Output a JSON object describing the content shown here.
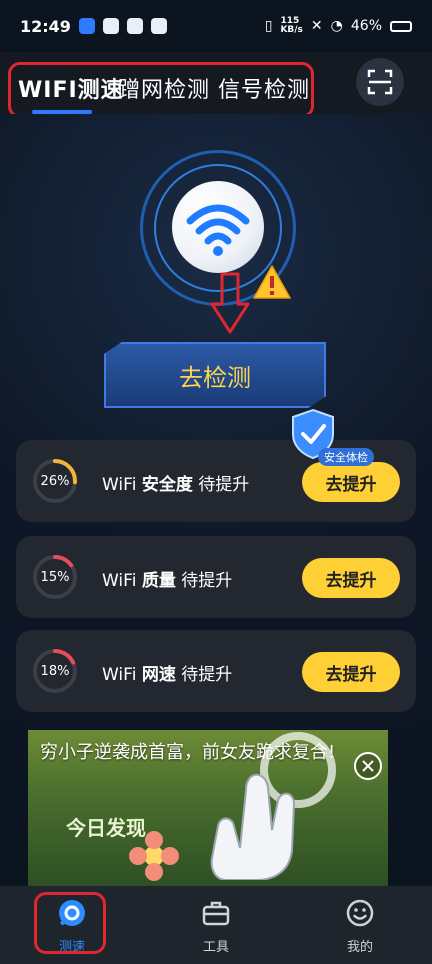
{
  "status": {
    "time": "12:49",
    "net_speed_value": "115",
    "net_speed_unit": "KB/s",
    "battery": "46%"
  },
  "tabs": [
    {
      "label": "WIFI测速",
      "active": true
    },
    {
      "label": "蹭网检测",
      "active": false
    },
    {
      "label": "信号检测",
      "active": false
    }
  ],
  "hero": {
    "check_button": "去检测",
    "badge": "安全体检"
  },
  "cards": [
    {
      "percent_text": "26%",
      "percent": 26,
      "prefix": "WiFi",
      "name": "安全度",
      "status": "待提升",
      "button": "去提升"
    },
    {
      "percent_text": "15%",
      "percent": 15,
      "prefix": "WiFi",
      "name": "质量",
      "status": "待提升",
      "button": "去提升"
    },
    {
      "percent_text": "18%",
      "percent": 18,
      "prefix": "WiFi",
      "name": "网速",
      "status": "待提升",
      "button": "去提升"
    }
  ],
  "ad": {
    "text": "穷小子逆袭成首富，前女友跪求复合!",
    "watermark": "今日发现"
  },
  "nav": [
    {
      "label": "测速",
      "icon": "speed-icon",
      "active": true
    },
    {
      "label": "工具",
      "icon": "toolbox-icon",
      "active": false
    },
    {
      "label": "我的",
      "icon": "smile-icon",
      "active": false
    }
  ],
  "colors": {
    "accent_blue": "#2d7cff",
    "button_yellow": "#ffd035",
    "annotation_red": "#e0262f",
    "gauge_yellow": "#f4b43a",
    "gauge_red": "#e74c5a"
  }
}
